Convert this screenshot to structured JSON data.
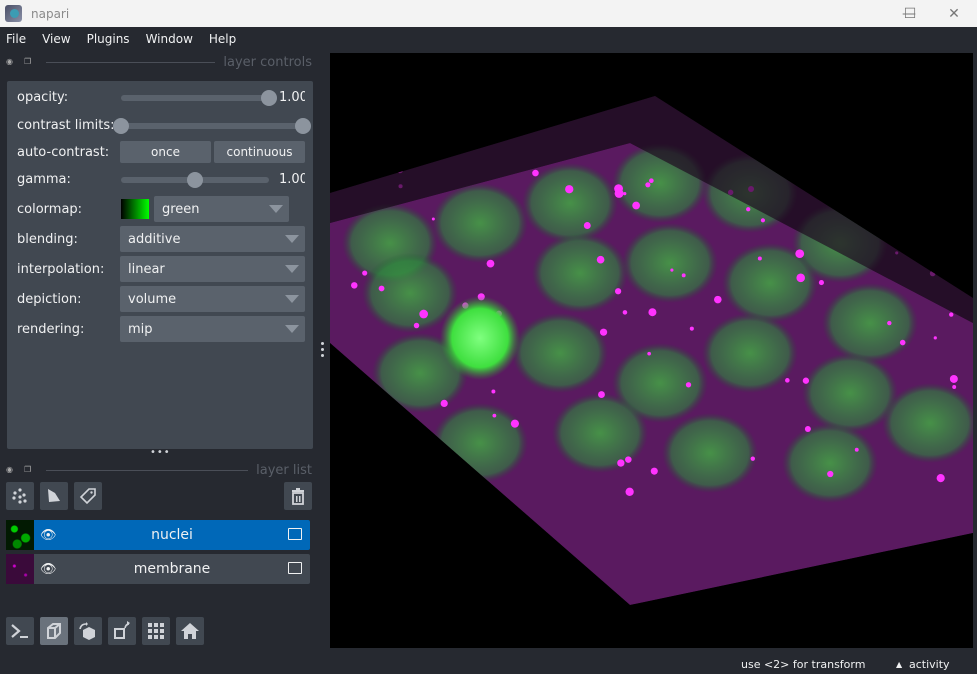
{
  "window": {
    "title": "napari",
    "minimize": "—",
    "maximize": "☐",
    "close": "✕"
  },
  "menubar": {
    "items": [
      "File",
      "View",
      "Plugins",
      "Window",
      "Help"
    ]
  },
  "layer_controls": {
    "header": "layer controls",
    "opacity": {
      "label": "opacity:",
      "value": "1.00",
      "fraction": 1.0
    },
    "contrast_limits": {
      "label": "contrast limits:",
      "low_fraction": 0.0,
      "high_fraction": 1.0
    },
    "auto_contrast": {
      "label": "auto-contrast:",
      "once": "once",
      "continuous": "continuous"
    },
    "gamma": {
      "label": "gamma:",
      "value": "1.00",
      "fraction": 0.5
    },
    "colormap": {
      "label": "colormap:",
      "value": "green",
      "swatch_color": "#00ff00"
    },
    "blending": {
      "label": "blending:",
      "value": "additive"
    },
    "interpolation": {
      "label": "interpolation:",
      "value": "linear"
    },
    "depiction": {
      "label": "depiction:",
      "value": "volume"
    },
    "rendering": {
      "label": "rendering:",
      "value": "mip"
    }
  },
  "layer_list": {
    "header": "layer list",
    "layers": [
      {
        "name": "nuclei",
        "selected": true,
        "thumb_color": "#00c000"
      },
      {
        "name": "membrane",
        "selected": false,
        "thumb_color": "#c000c0"
      }
    ]
  },
  "colors": {
    "selected": "#0068b8",
    "panel": "#414851",
    "background": "#262930",
    "accent_green": "#00ff00",
    "accent_magenta": "#ff00ff"
  },
  "status": {
    "hint": "use <2> for transform",
    "activity": "activity"
  }
}
